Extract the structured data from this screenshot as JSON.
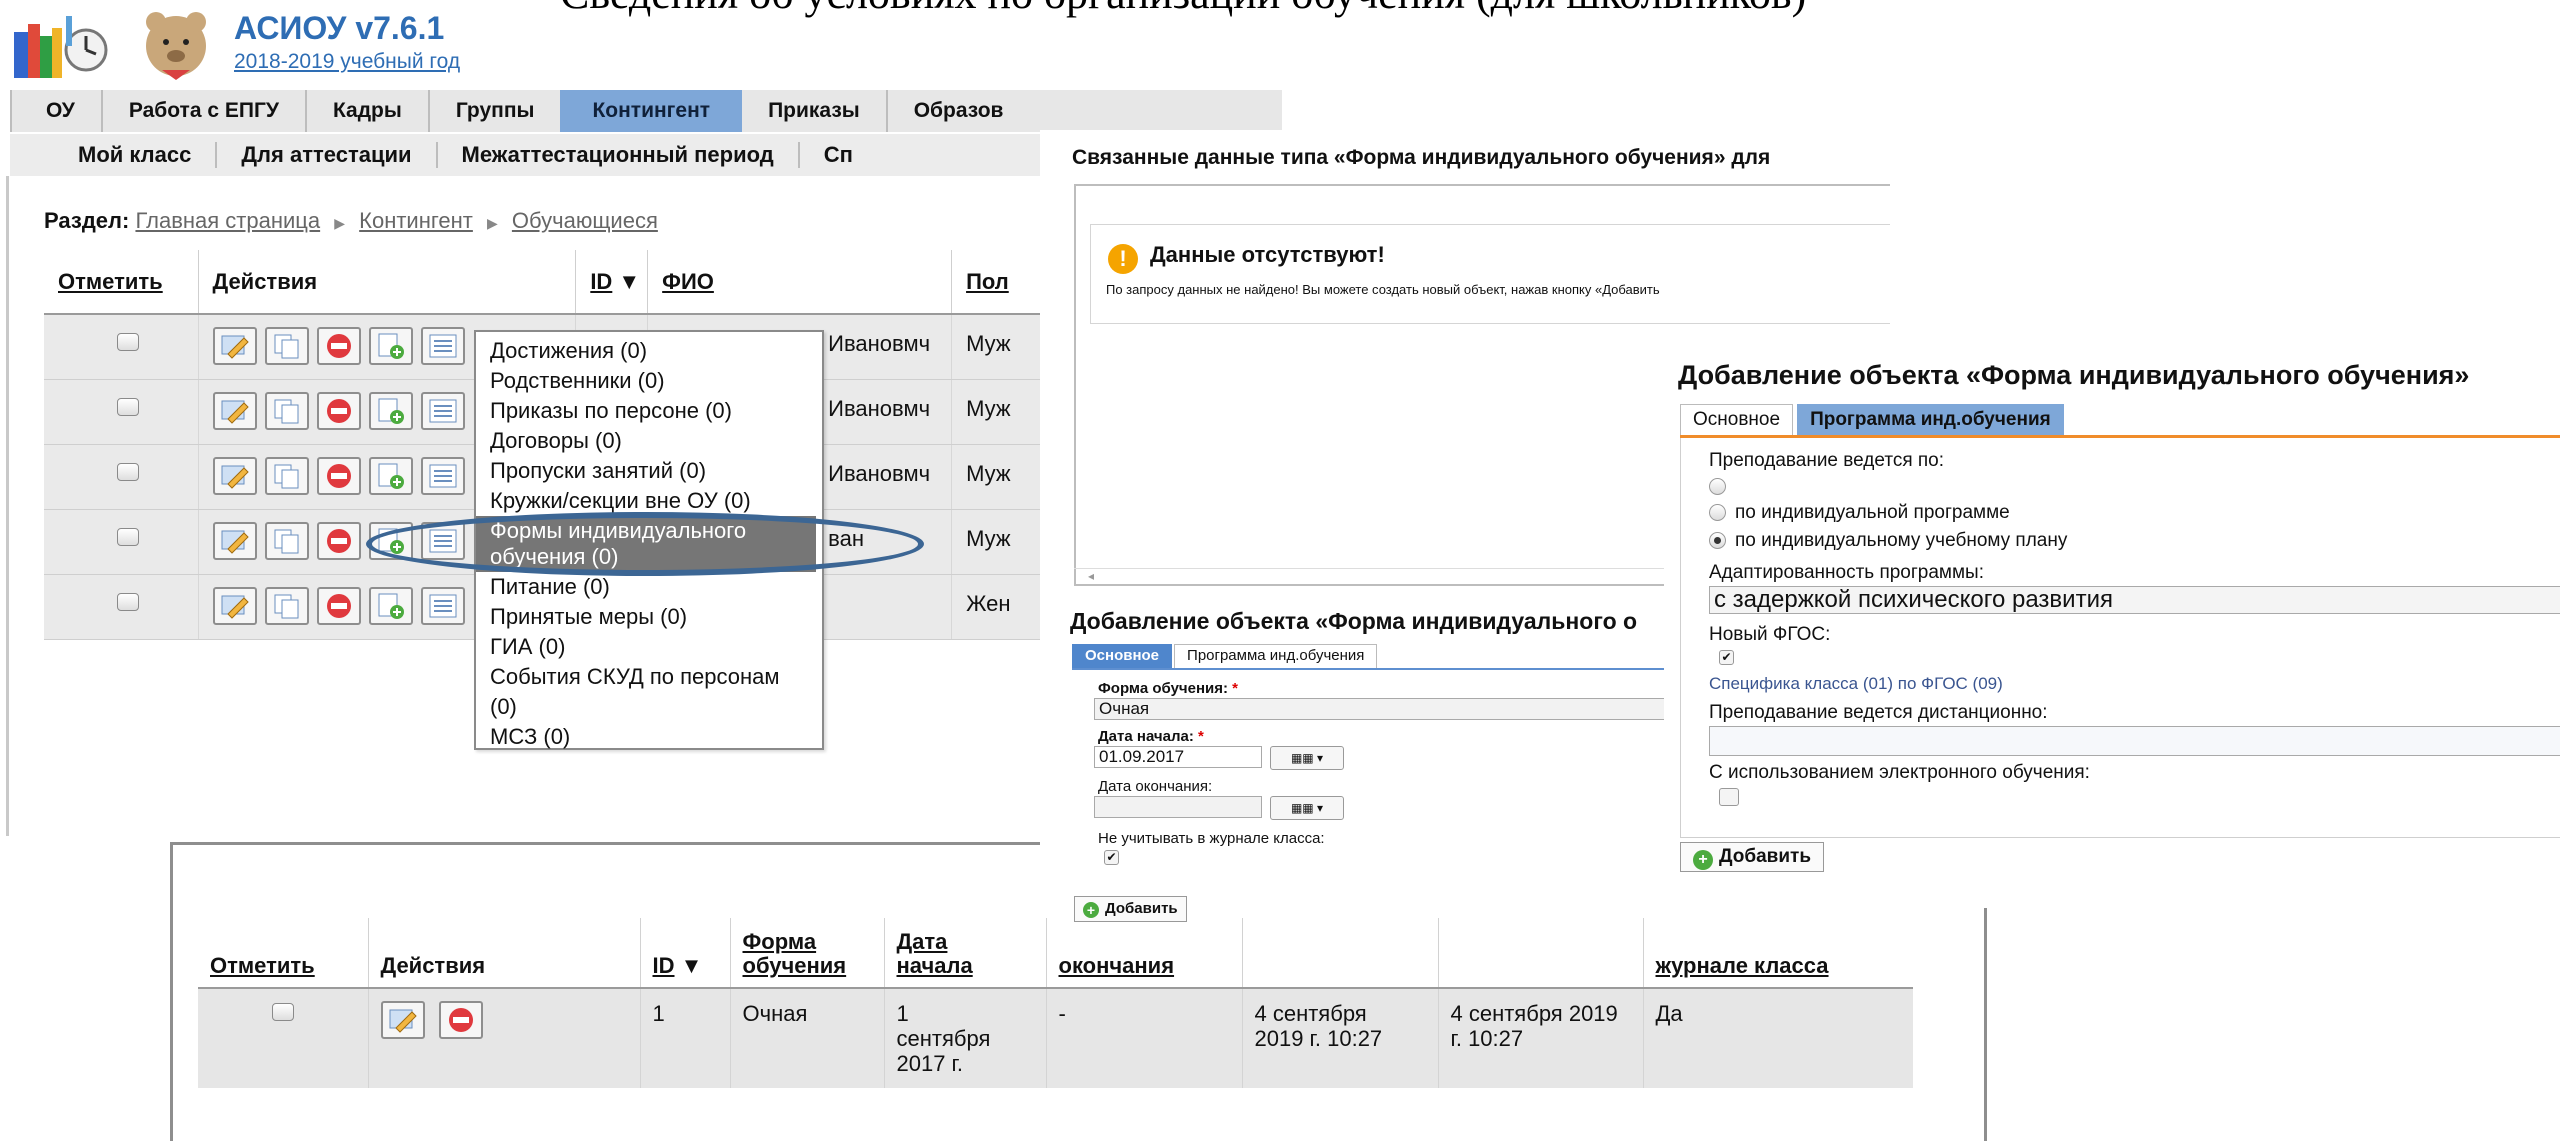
{
  "slide": {
    "title": "Сведения об условиях по организации обучения (для школьников)"
  },
  "app": {
    "name": "АСИОУ v7.6.1",
    "year": "2018-2019 учебный год"
  },
  "nav_top": [
    "ОУ",
    "Работа с ЕПГУ",
    "Кадры",
    "Группы",
    "Контингент",
    "Приказы",
    "Образов"
  ],
  "nav_active": "Контингент",
  "nav_sub": [
    "Мой класс",
    "Для аттестации",
    "Межаттестационный период",
    "Сп"
  ],
  "breadcrumb": {
    "label": "Раздел:",
    "items": [
      "Главная страница",
      "Контингент",
      "Обучающиеся"
    ]
  },
  "main_table": {
    "headers": {
      "mark": "Отметить",
      "actions": "Действия",
      "id": "ID",
      "fio": "ФИО",
      "sex": "Пол"
    },
    "rows": [
      {
        "fio": "Ивановмч",
        "sex": "Муж"
      },
      {
        "fio": "Ивановмч",
        "sex": "Муж"
      },
      {
        "fio": "Ивановмч",
        "sex": "Муж"
      },
      {
        "fio": "ван",
        "sex": "Муж"
      },
      {
        "fio": "",
        "sex": "Жен"
      }
    ]
  },
  "popup_menu": {
    "items": [
      "Достижения (0)",
      "Родственники (0)",
      "Приказы по персоне (0)",
      "Договоры (0)",
      "Пропуски занятий (0)",
      "Кружки/секции вне ОУ (0)",
      "Формы индивидуального обучения (0)",
      "Питание (0)",
      "Принятые меры (0)",
      "ГИА (0)",
      "События СКУД по персонам (0)",
      "МСЗ (0)"
    ],
    "highlighted_index": 6
  },
  "bottom_table": {
    "headers": {
      "mark": "Отметить",
      "actions": "Действия",
      "id": "ID",
      "form": "Форма обучения",
      "start": "Дата начала",
      "end": "окончания",
      "journal": "журнале класса"
    },
    "row": {
      "id": "1",
      "form": "Очная",
      "start": "1 сентября 2017 г.",
      "end": "-",
      "created": "4 сентября 2019 г. 10:27",
      "modified": "4 сентября 2019 г. 10:27",
      "journal": "Да"
    }
  },
  "related_window": {
    "title": "Связанные данные типа «Форма индивидуального обучения» для",
    "warn_title": "Данные отсутствуют!",
    "warn_text": "По запросу данных не найдено! Вы можете создать новый объект, нажав кнопку «Добавить"
  },
  "small_form": {
    "title": "Добавление объекта «Форма индивидуального о",
    "tabs": [
      "Основное",
      "Программа инд.обучения"
    ],
    "form_label": "Форма обучения:",
    "form_value": "Очная",
    "start_label": "Дата начала:",
    "start_value": "01.09.2017",
    "end_label": "Дата окончания:",
    "end_value": "",
    "journal_label": "Не учитывать в журнале класса:",
    "add_label": "Добавить"
  },
  "big_form": {
    "title": "Добавление объекта «Форма индивидуального обучения»",
    "tabs": [
      "Основное",
      "Программа инд.обучения"
    ],
    "teaching_label": "Преподавание ведется по:",
    "radio_options": [
      "",
      "по индивидуальной программе",
      "по индивидуальному учебному плану"
    ],
    "radio_selected": 2,
    "adapt_label": "Адаптированность программы:",
    "adapt_value": "с задержкой психического развития",
    "fgos_label": "Новый ФГОС:",
    "spec_link": "Специфика класса (01) по ФГОС (09)",
    "remote_label": "Преподавание ведется дистанционно:",
    "elearn_label": "С использованием электронного обучения:",
    "add_label": "Добавить"
  },
  "colors": {
    "nav_active": "#7ea7d8",
    "link": "#2e6db4",
    "ellipse": "#3c6694",
    "tab_orange": "#f08c2a",
    "tab_blue": "#4f86cc"
  }
}
